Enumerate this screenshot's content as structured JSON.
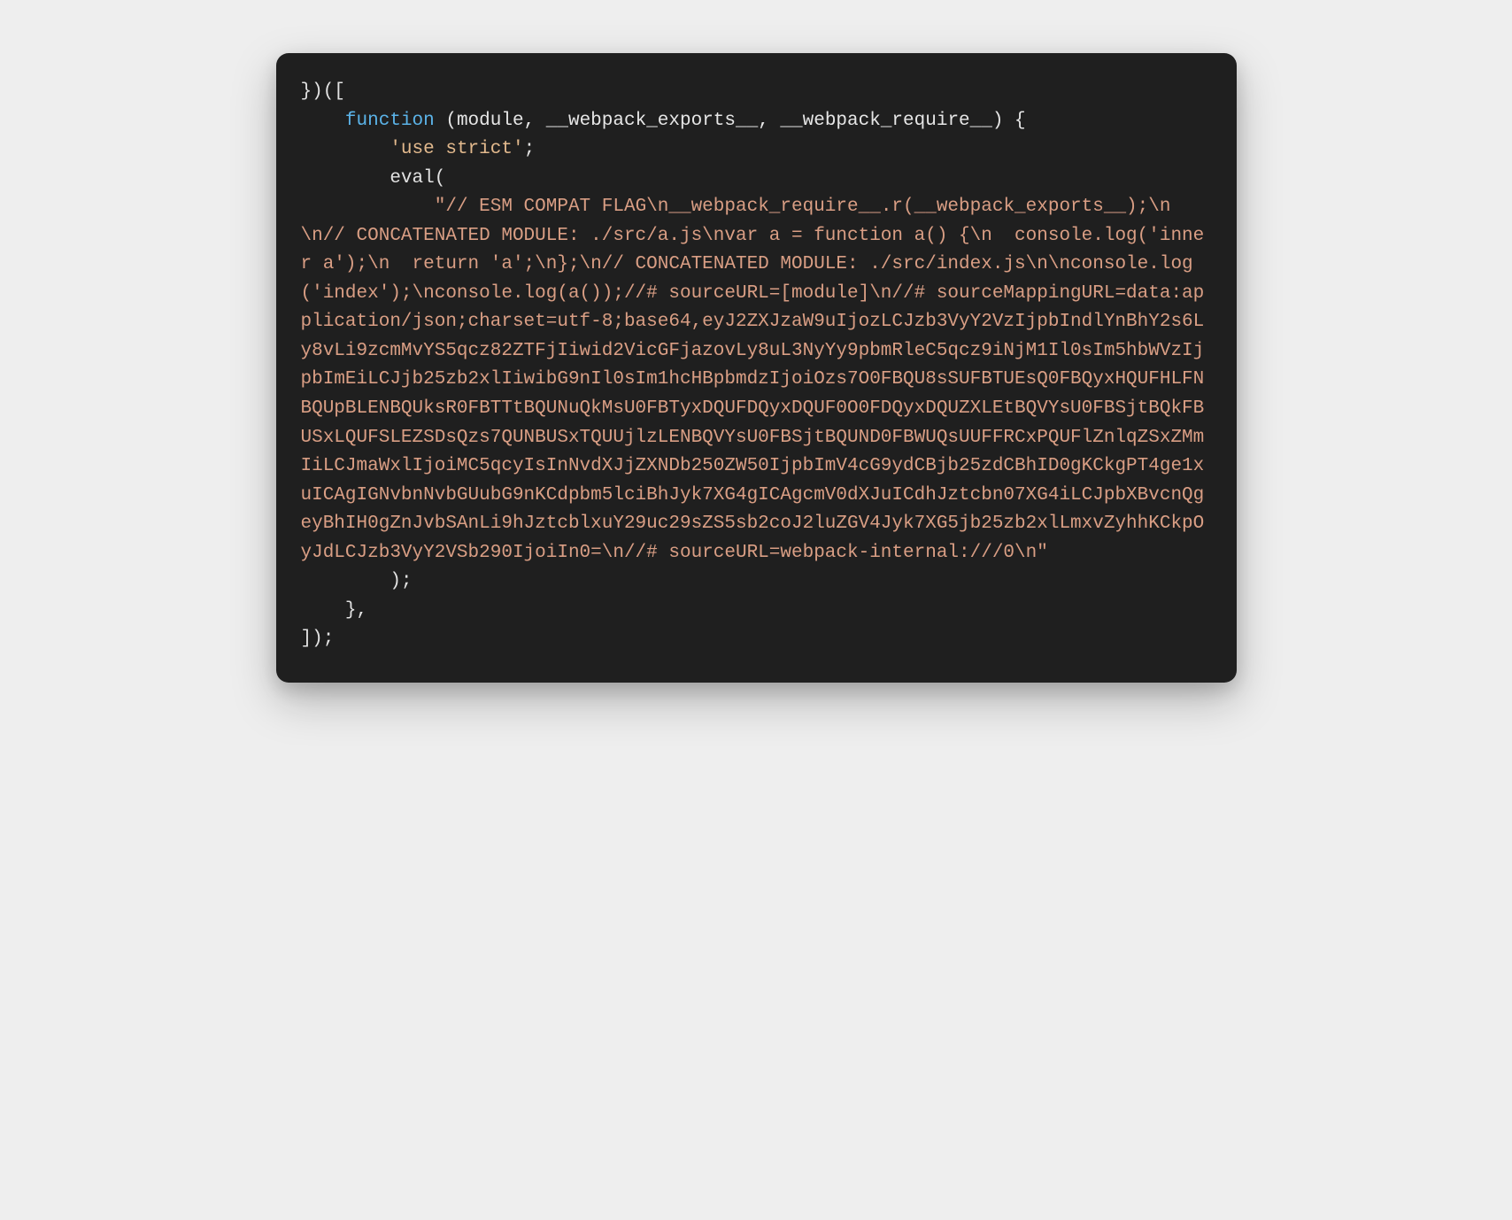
{
  "code": {
    "line1_a": "})([",
    "line2_a": "    ",
    "line2_kw": "function",
    "line2_b": " (module, __webpack_exports__, __webpack_require__) {",
    "line3_a": "        ",
    "line3_str": "'use strict'",
    "line3_b": ";",
    "line4_a": "        eval(",
    "line5_a": "            ",
    "line5_str": "\"// ESM COMPAT FLAG\\n__webpack_require__.r(__webpack_exports__);\\n\\n// CONCATENATED MODULE: ./src/a.js\\nvar a = function a() {\\n  console.log('inner a');\\n  return 'a';\\n};\\n// CONCATENATED MODULE: ./src/index.js\\n\\nconsole.log('index');\\nconsole.log(a());//# sourceURL=[module]\\n//# sourceMappingURL=data:application/json;charset=utf-8;base64,eyJ2ZXJzaW9uIjozLCJzb3VyY2VzIjpbIndlYnBhY2s6Ly8vLi9zcmMvYS5qcz82ZTFjIiwid2VicGFjazovLy8uL3NyYy9pbmRleC5qcz9iNjM1Il0sIm5hbWVzIjpbImEiLCJjb25zb2xlIiwibG9nIl0sIm1hcHBpbmdzIjoiOzs7O0FBQU8sSUFBTUEsQ0FBQyxHQUFHLFNBQUpBLENBQUksR0FBTTtBQUNuQkMsU0FBTyxDQUFDQyxDQUF0O0FDQyxDQUZXLEtBQVYsU0FBSjtBQkFBUSxLQUFSLEZSDsQzs7QUNBUSxTQUUjlzLENBQVYsU0FBSjtBQUND0FBWUQsUUFFRCxPQUFlZnlqZSxZMmIiLCJmaWxlIjoiMC5qcyIsInNvdXJjZXNDb250ZW50IjpbImV4cG9ydCBjb25zdCBhID0gKCkgPT4ge1xuICAgIGNvbnNvbGUubG9nKCdpbm5lciBhJyk7XG4gICAgcmV0dXJuICdhJztcbn07XG4iLCJpbXBvcnQgeyBhIH0gZnJvbSAnLi9hJztcblxuY29uc29sZS5sb2coJ2luZGV4Jyk7XG5jb25zb2xlLmxvZyhhKCkpOyJdLCJzb3VyY2VSb290IjoiIn0=\\n//# sourceURL=webpack-internal:///0\\n\"",
    "line6_a": "        );",
    "line7_a": "    },",
    "line8_a": "]);"
  }
}
